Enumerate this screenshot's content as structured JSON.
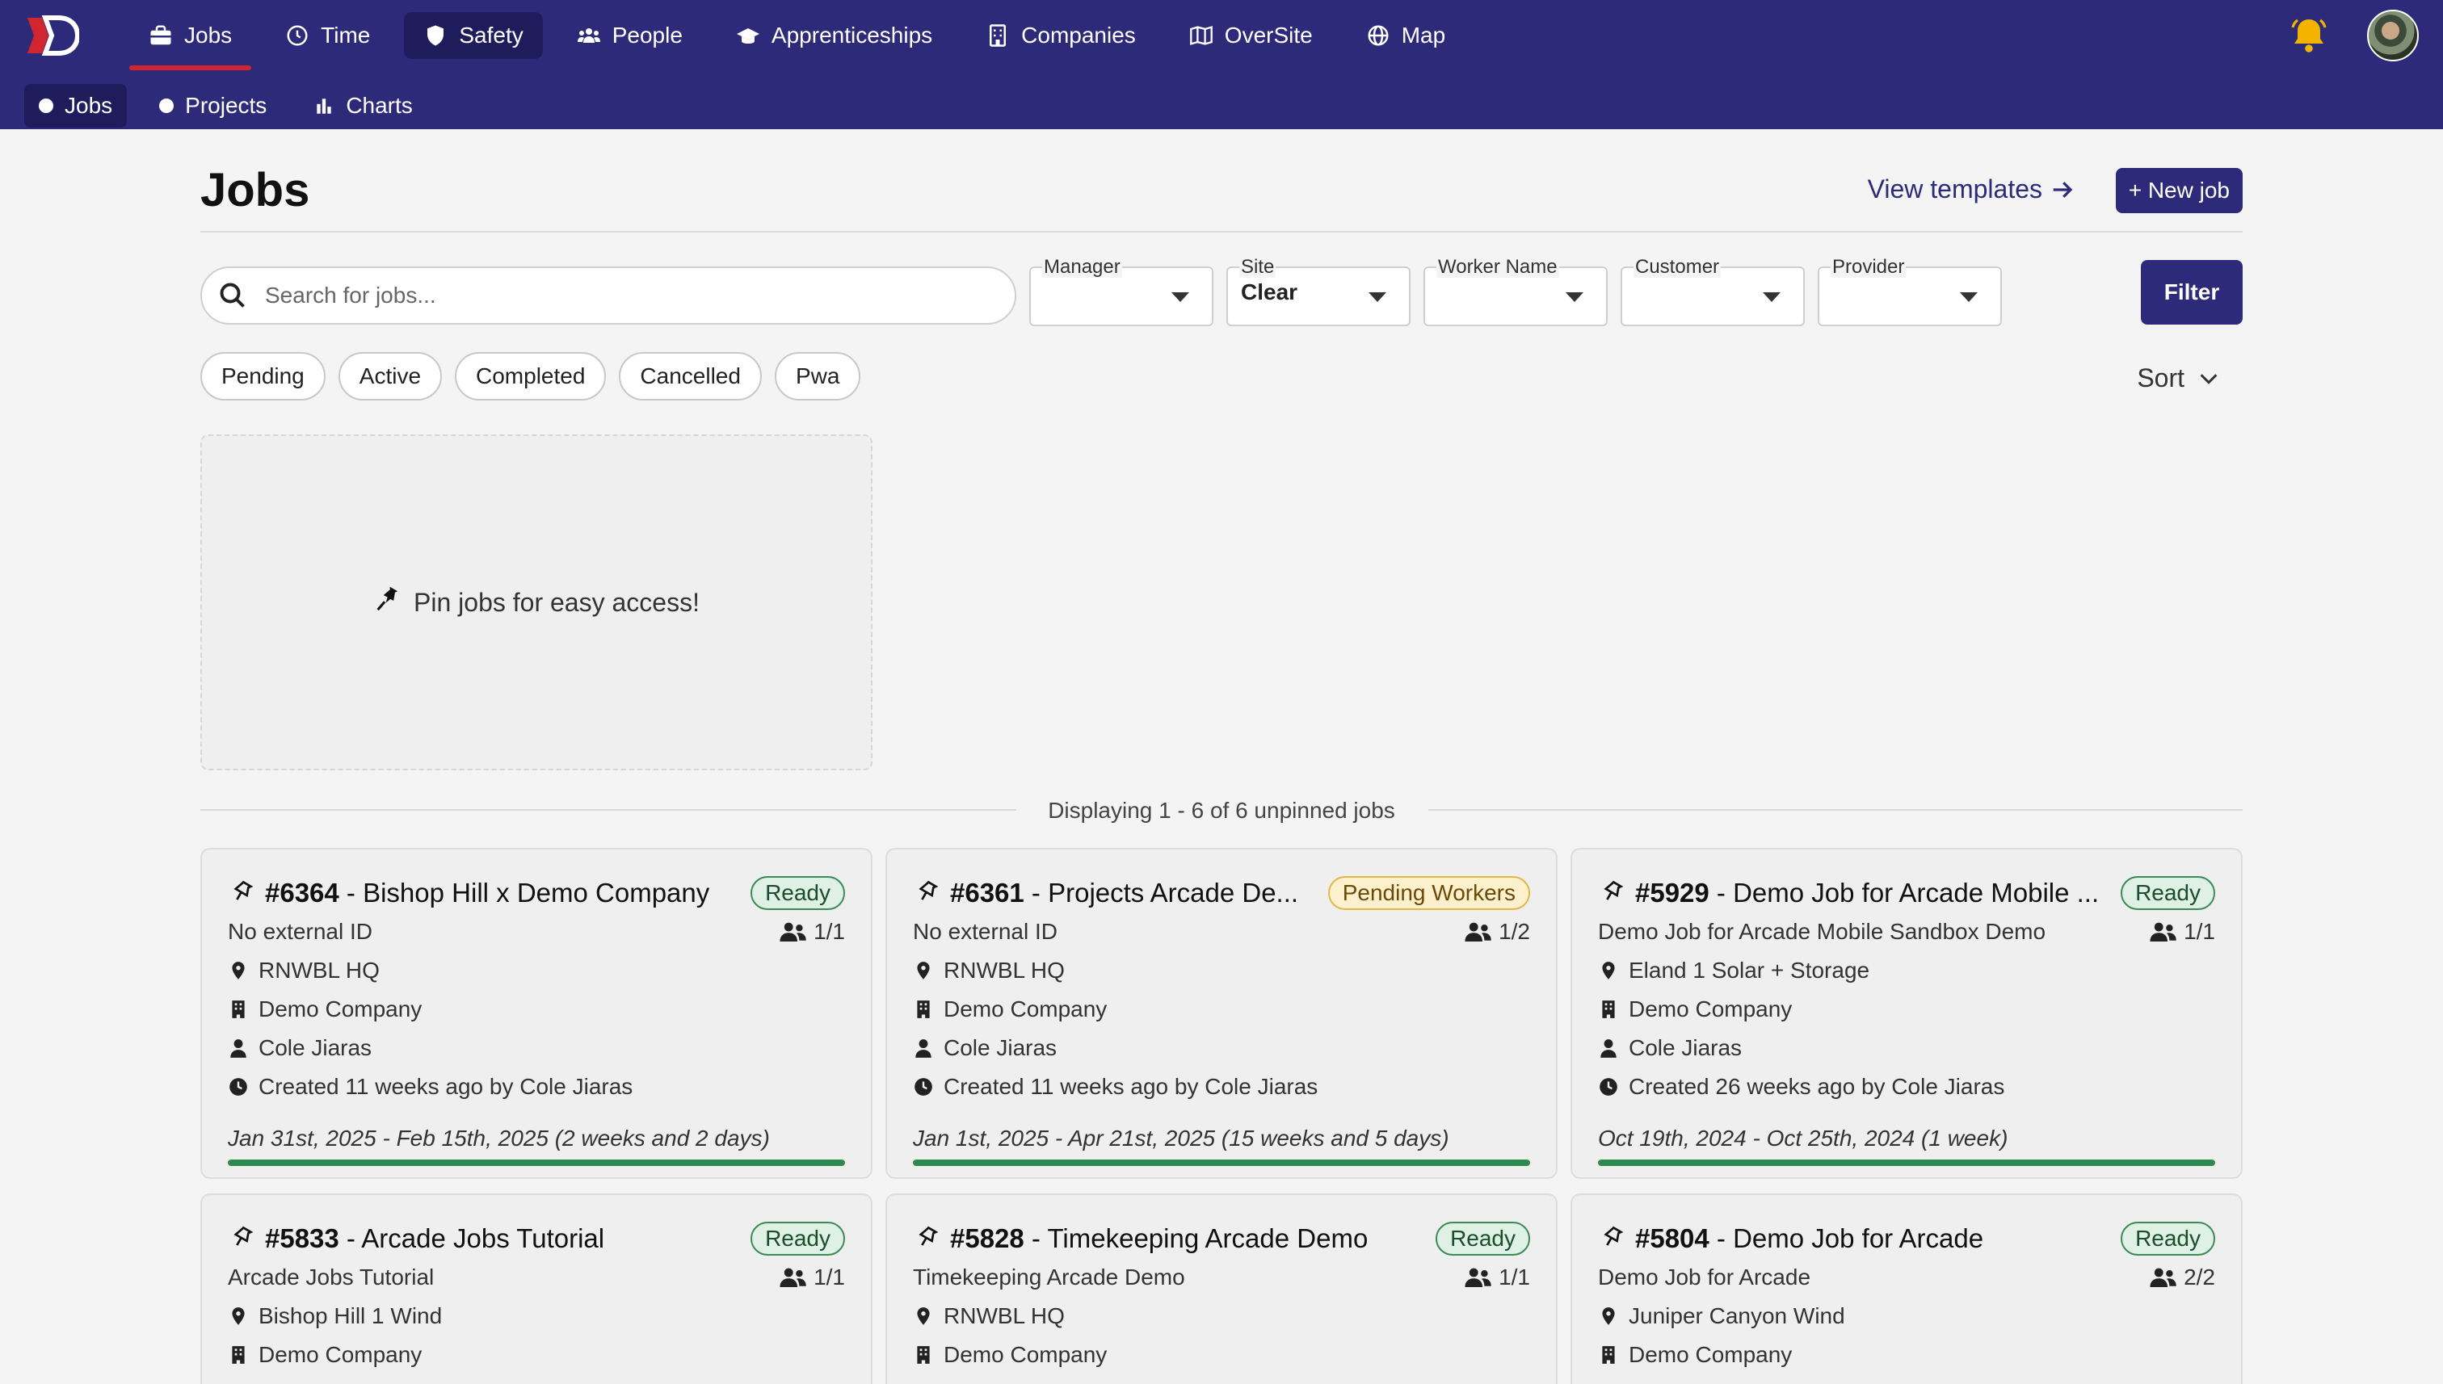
{
  "nav": {
    "main": [
      {
        "label": "Jobs",
        "icon": "briefcase-icon"
      },
      {
        "label": "Time",
        "icon": "clock-icon"
      },
      {
        "label": "Safety",
        "icon": "shield-icon"
      },
      {
        "label": "People",
        "icon": "people-icon"
      },
      {
        "label": "Apprenticeships",
        "icon": "graduation-cap-icon"
      },
      {
        "label": "Companies",
        "icon": "building-icon"
      },
      {
        "label": "OverSite",
        "icon": "map-fold-icon"
      },
      {
        "label": "Map",
        "icon": "globe-icon"
      }
    ],
    "sub": [
      {
        "label": "Jobs"
      },
      {
        "label": "Projects"
      },
      {
        "label": "Charts"
      }
    ]
  },
  "page": {
    "title": "Jobs",
    "view_templates": "View templates",
    "new_job": "+ New job"
  },
  "search": {
    "placeholder": "Search for jobs..."
  },
  "filters": {
    "manager": "Manager",
    "site": "Site",
    "worker_name": "Worker Name",
    "customer": "Customer",
    "provider": "Provider",
    "clear": "Clear",
    "filter": "Filter"
  },
  "chips": [
    "Pending",
    "Active",
    "Completed",
    "Cancelled",
    "Pwa"
  ],
  "sort": "Sort",
  "pin_message": "Pin jobs for easy access!",
  "displaying": "Displaying 1 - 6 of 6 unpinned jobs",
  "colors": {
    "nav": "#2d2a7a",
    "active_underline": "#d1262f",
    "progress": "#2f8a4f"
  },
  "jobs": [
    {
      "number": "#6364",
      "title": " - Bishop Hill x Demo Company",
      "status": "Ready",
      "external": "No external ID",
      "workers": "1/1",
      "site": "RNWBL HQ",
      "company": "Demo Company",
      "manager": "Cole Jiaras",
      "created": "Created 11 weeks ago by Cole Jiaras",
      "dates": "Jan 31st, 2025 - Feb 15th, 2025 (2 weeks and 2 days)",
      "progress": 1.0
    },
    {
      "number": "#6361",
      "title": " - Projects Arcade De...",
      "status": "Pending Workers",
      "external": "No external ID",
      "workers": "1/2",
      "site": "RNWBL HQ",
      "company": "Demo Company",
      "manager": "Cole Jiaras",
      "created": "Created 11 weeks ago by Cole Jiaras",
      "dates": "Jan 1st, 2025 - Apr 21st, 2025 (15 weeks and 5 days)",
      "progress": 1.0
    },
    {
      "number": "#5929",
      "title": " - Demo Job for Arcade Mobile ...",
      "status": "Ready",
      "external": "Demo Job for Arcade Mobile Sandbox Demo",
      "workers": "1/1",
      "site": "Eland 1 Solar + Storage",
      "company": "Demo Company",
      "manager": "Cole Jiaras",
      "created": "Created 26 weeks ago by Cole Jiaras",
      "dates": "Oct 19th, 2024 - Oct 25th, 2024 (1 week)",
      "progress": 1.0
    },
    {
      "number": "#5833",
      "title": " - Arcade Jobs Tutorial",
      "status": "Ready",
      "external": "Arcade Jobs Tutorial",
      "workers": "1/1",
      "site": "Bishop Hill 1 Wind",
      "company": "Demo Company"
    },
    {
      "number": "#5828",
      "title": " - Timekeeping Arcade Demo",
      "status": "Ready",
      "external": "Timekeeping Arcade Demo",
      "workers": "1/1",
      "site": "RNWBL HQ",
      "company": "Demo Company"
    },
    {
      "number": "#5804",
      "title": " - Demo Job for Arcade",
      "status": "Ready",
      "external": "Demo Job for Arcade",
      "workers": "2/2",
      "site": "Juniper Canyon Wind",
      "company": "Demo Company"
    }
  ]
}
